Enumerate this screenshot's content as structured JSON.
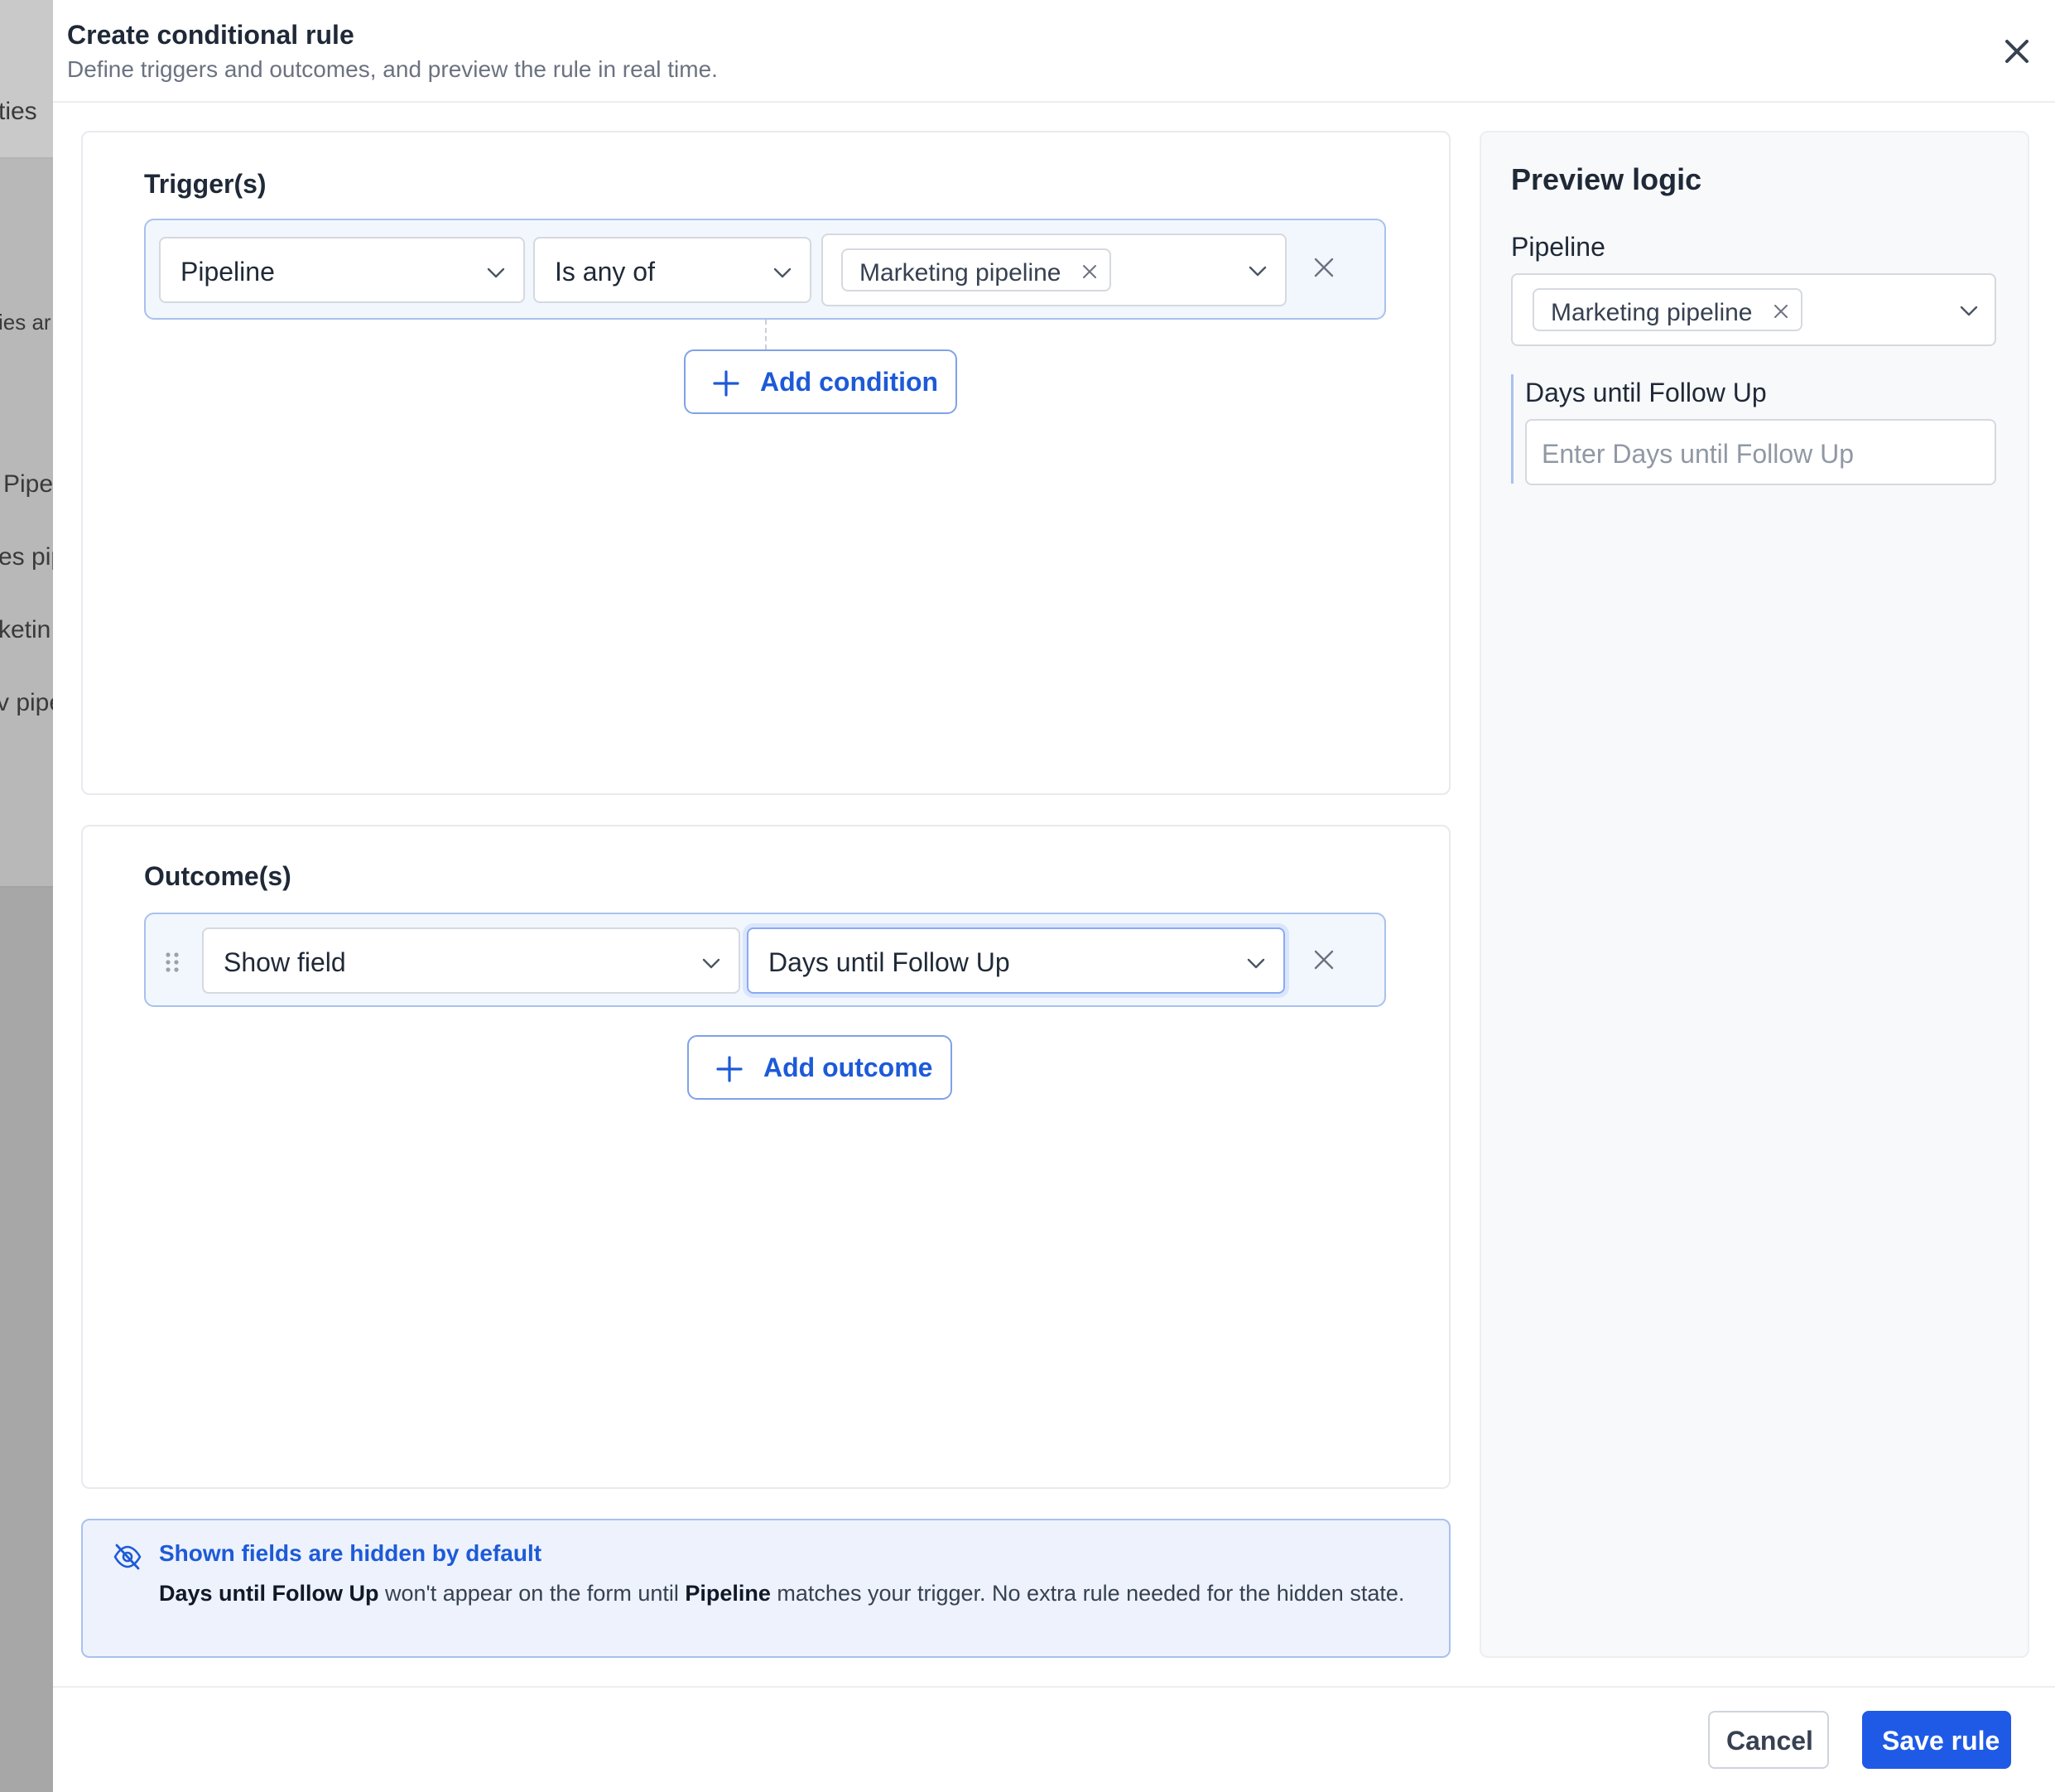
{
  "background_page": {
    "fragments": [
      "ties",
      "ies ar",
      "Pipe",
      "es pip",
      "ketin",
      "v pipe"
    ]
  },
  "modal": {
    "title": "Create conditional rule",
    "subtitle": "Define triggers and outcomes, and preview the rule in real time.",
    "close_icon": "close-icon"
  },
  "triggers": {
    "title": "Trigger(s)",
    "rows": [
      {
        "field": "Pipeline",
        "operator": "Is any of",
        "values": [
          "Marketing pipeline"
        ]
      }
    ],
    "add_label": "Add condition"
  },
  "outcomes": {
    "title": "Outcome(s)",
    "rows": [
      {
        "action": "Show field",
        "target": "Days until Follow Up"
      }
    ],
    "add_label": "Add outcome"
  },
  "info": {
    "title": "Shown fields are hidden by default",
    "body_field": "Days until Follow Up",
    "body_mid": " won't appear on the form until ",
    "body_trigger": "Pipeline",
    "body_end": " matches your trigger. No extra rule needed for the hidden state.",
    "icon": "eye-off-icon"
  },
  "preview": {
    "title": "Preview logic",
    "pipeline_label": "Pipeline",
    "pipeline_value": "Marketing pipeline",
    "days_label": "Days until Follow Up",
    "days_placeholder": "Enter Days until Follow Up"
  },
  "footer": {
    "cancel_label": "Cancel",
    "save_label": "Save rule"
  },
  "colors": {
    "accent": "#1f5ae6",
    "link": "#1d5ad8",
    "row_border": "#a7c2ee",
    "row_bg": "#f2f6fd",
    "info_bg": "#edf2fc"
  }
}
